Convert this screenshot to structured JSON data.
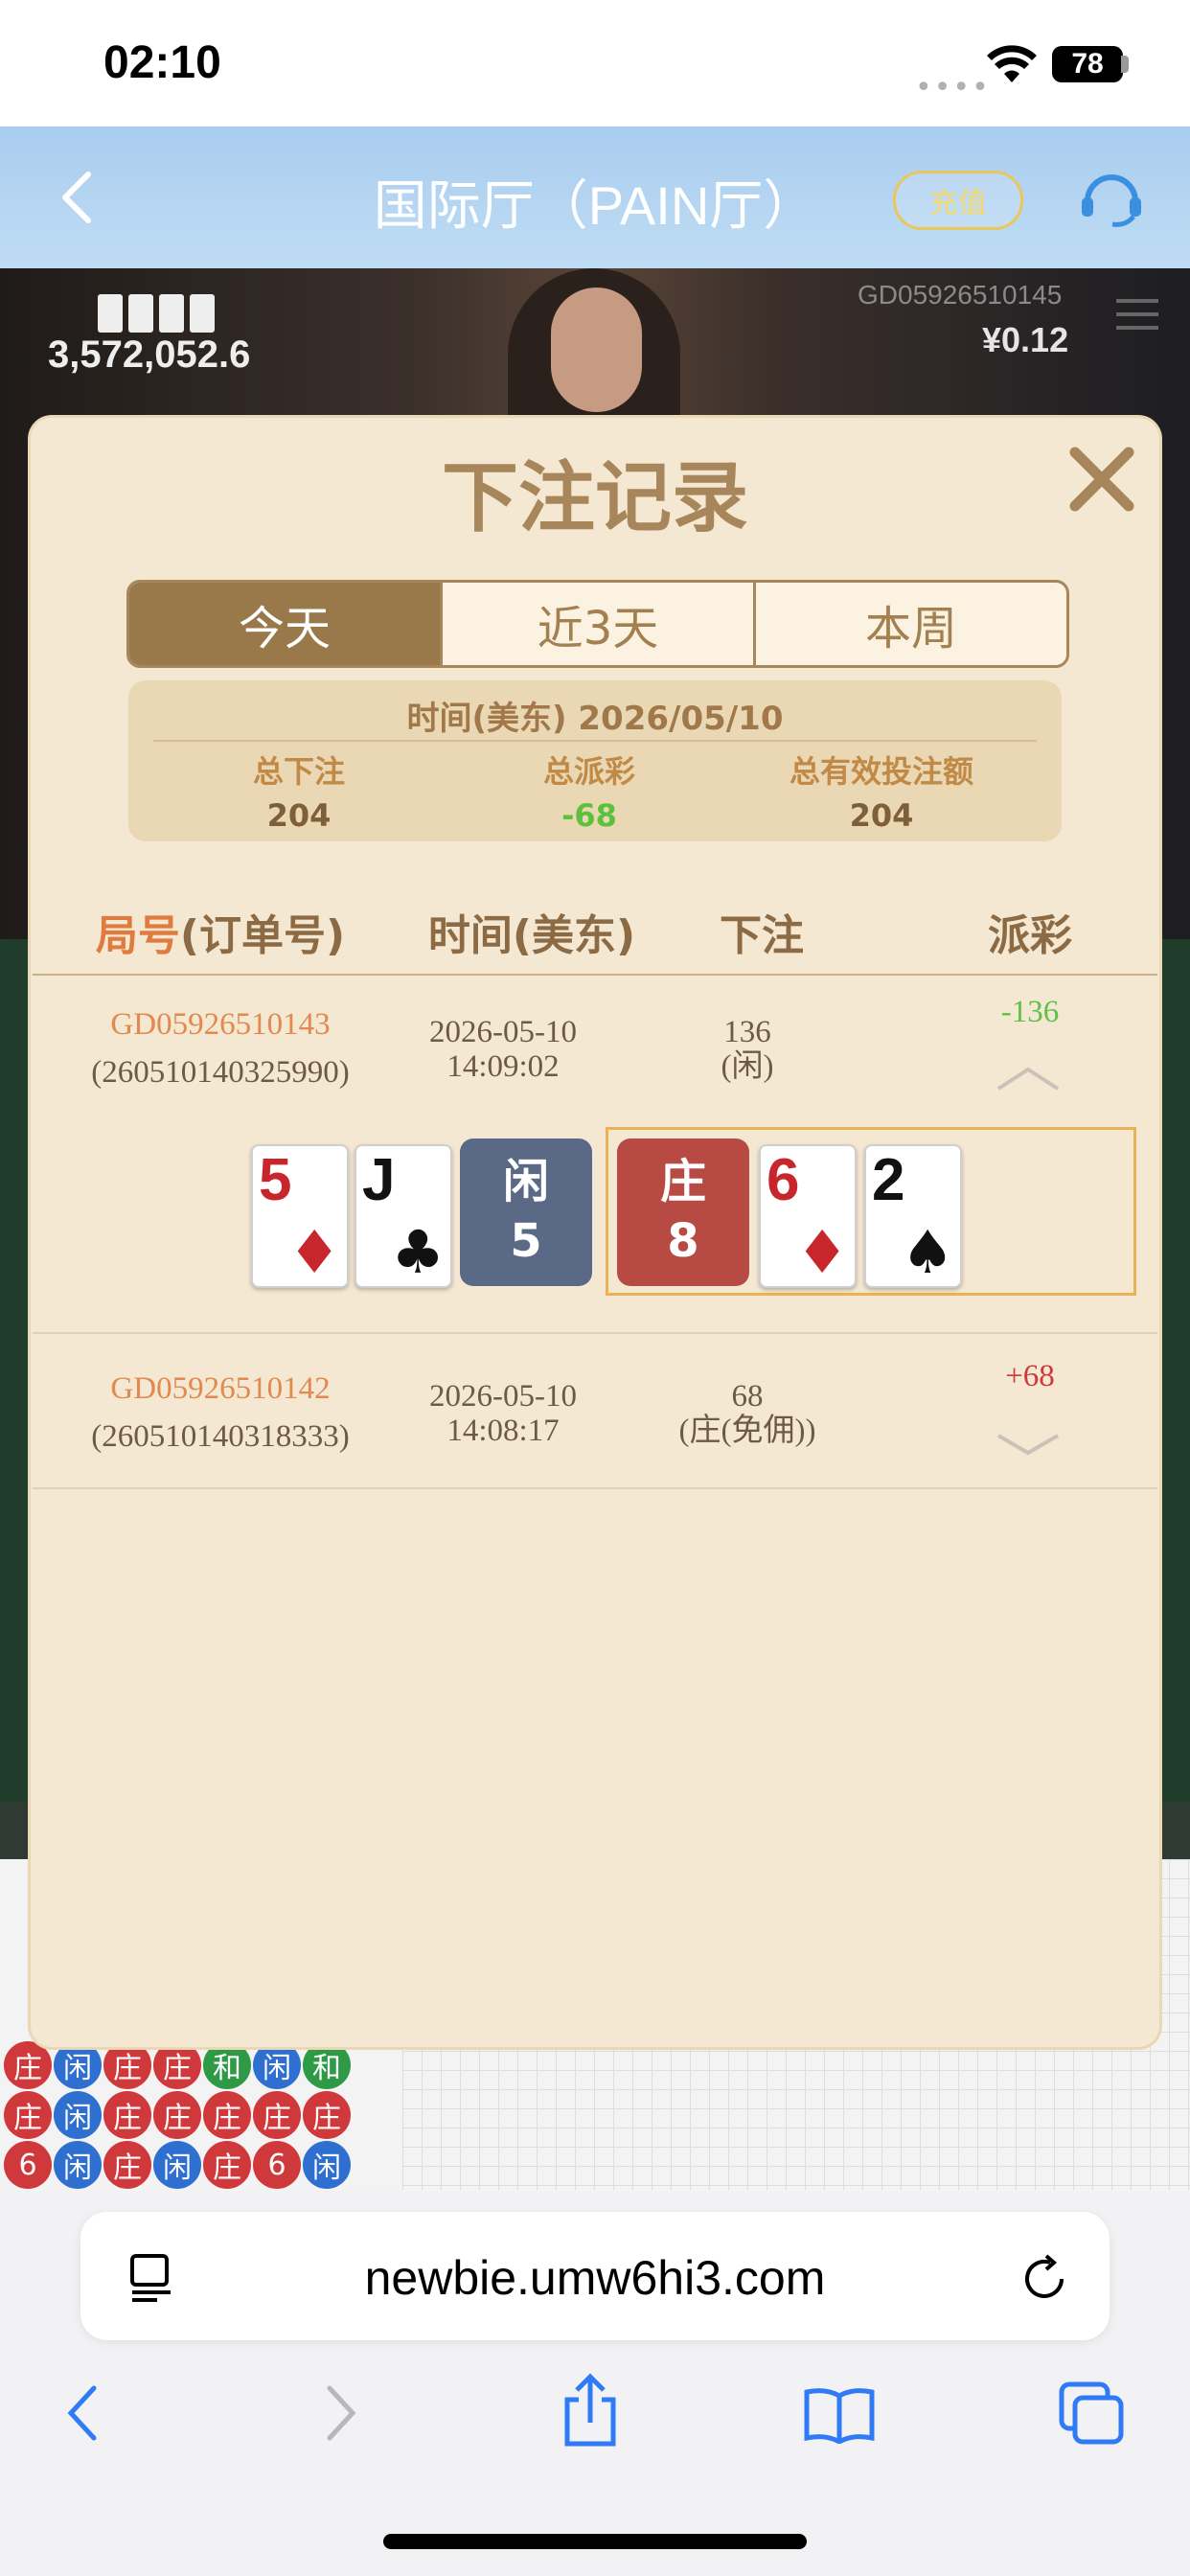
{
  "status_bar": {
    "time": "02:10",
    "battery": "78"
  },
  "header": {
    "title": "国际厅（PAIN厅）",
    "recharge_label": "充值"
  },
  "background": {
    "total_amount": "3,572,052.6",
    "round_id": "GD05926510145",
    "balance": "¥0.12",
    "road_beads": [
      "庄",
      "庄",
      "6",
      "闲",
      "闲",
      "闲",
      "庄",
      "庄",
      "庄",
      "庄",
      "庄",
      "闲",
      "和",
      "庄",
      "庄",
      "闲",
      "庄",
      "6",
      "和",
      "庄",
      "闲"
    ]
  },
  "modal": {
    "title": "下注记录",
    "tabs": [
      {
        "label": "今天",
        "active": true
      },
      {
        "label": "近3天",
        "active": false
      },
      {
        "label": "本周",
        "active": false
      }
    ],
    "summary": {
      "date_line": "时间(美东) 2026/05/10",
      "total_bet_label": "总下注",
      "total_bet": "204",
      "total_payout_label": "总派彩",
      "total_payout": "-68",
      "valid_bet_label": "总有效投注额",
      "valid_bet": "204"
    },
    "columns": {
      "round_main": "局号",
      "round_sub": "(订单号)",
      "time": "时间(美东)",
      "bet": "下注",
      "payout": "派彩"
    },
    "rows": [
      {
        "round_id": "GD05926510143",
        "order_id": "(260510140325990)",
        "date": "2026-05-10",
        "time": "14:09:02",
        "bet_amount": "136",
        "bet_type": "(闲)",
        "payout": "-136",
        "expanded": true,
        "player": {
          "label": "闲",
          "score": "5",
          "cards": [
            {
              "rank": "5",
              "suit": "♦"
            },
            {
              "rank": "J",
              "suit": "♣"
            }
          ]
        },
        "banker": {
          "label": "庄",
          "score": "8",
          "cards": [
            {
              "rank": "6",
              "suit": "♦"
            },
            {
              "rank": "2",
              "suit": "♠"
            }
          ]
        }
      },
      {
        "round_id": "GD05926510142",
        "order_id": "(260510140318333)",
        "date": "2026-05-10",
        "time": "14:08:17",
        "bet_amount": "68",
        "bet_type": "(庄(免佣))",
        "payout": "+68",
        "expanded": false
      }
    ]
  },
  "browser": {
    "url": "newbie.umw6hi3.com"
  },
  "colors": {
    "accent": "#a8865c",
    "tab_active": "#997849",
    "negative": "#5ec24a",
    "positive": "#d0393b",
    "banker": "#b84a44",
    "player": "#5a6a86"
  }
}
